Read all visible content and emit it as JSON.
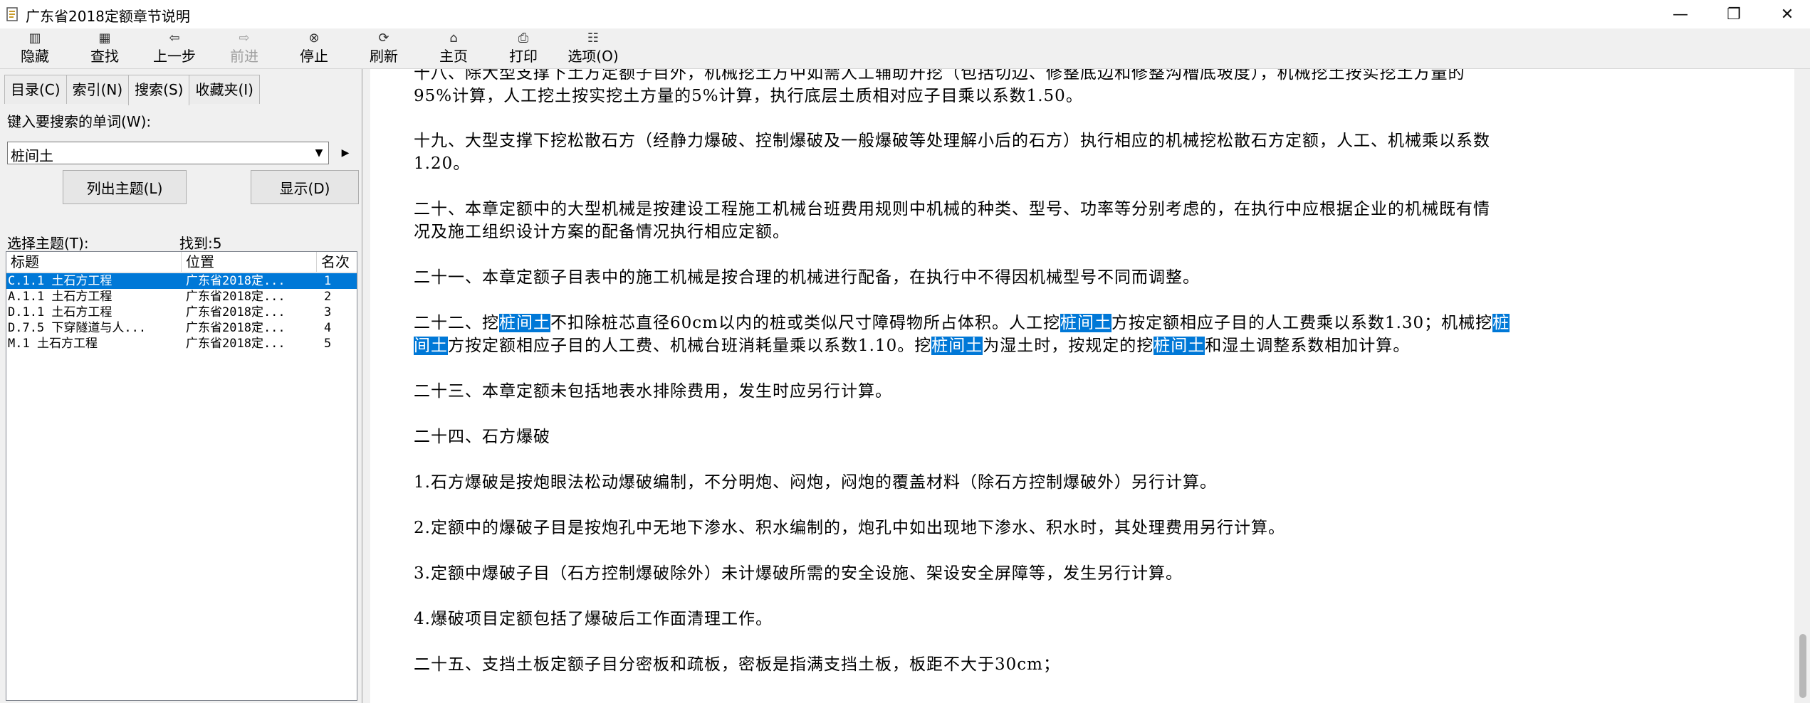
{
  "window": {
    "title": "广东省2018定额章节说明"
  },
  "toolbar": {
    "buttons": [
      {
        "label": "隐藏",
        "icon": "hide-icon"
      },
      {
        "label": "查找",
        "icon": "find-icon"
      },
      {
        "label": "上一步",
        "icon": "back-arrow-icon"
      },
      {
        "label": "前进",
        "icon": "forward-arrow-icon"
      },
      {
        "label": "停止",
        "icon": "stop-icon"
      },
      {
        "label": "刷新",
        "icon": "refresh-icon"
      },
      {
        "label": "主页",
        "icon": "home-icon"
      },
      {
        "label": "打印",
        "icon": "print-icon"
      },
      {
        "label": "选项(O)",
        "icon": "options-icon"
      }
    ]
  },
  "left": {
    "tabs": [
      "目录(C)",
      "索引(N)",
      "搜索(S)",
      "收藏夹(I)"
    ],
    "search_label": "键入要搜索的单词(W):",
    "search_value": "桩间土",
    "list_topics_button": "列出主题(L)",
    "display_button": "显示(D)",
    "select_topic_label": "选择主题(T):",
    "found_label": "找到:5",
    "columns": [
      "标题",
      "位置",
      "名次"
    ],
    "rows": [
      {
        "title": "C.1.1 土石方工程",
        "location": "广东省2018定...",
        "rank": "1"
      },
      {
        "title": "A.1.1 土石方工程",
        "location": "广东省2018定...",
        "rank": "2"
      },
      {
        "title": "D.1.1 土石方工程",
        "location": "广东省2018定...",
        "rank": "3"
      },
      {
        "title": "D.7.5 下穿隧道与人...",
        "location": "广东省2018定...",
        "rank": "4"
      },
      {
        "title": "M.1 土石方工程",
        "location": "广东省2018定...",
        "rank": "5"
      }
    ]
  },
  "content": {
    "p18_l1": "十八、除大型支撑下土方定额子目外，机械挖土方中如需人工辅助开挖（包括切边、修整底边和修整沟槽底坡度），机械挖土按实挖土方量的",
    "p18_l2": "95%计算，人工挖土按实挖土方量的5%计算，执行底层土质相对应子目乘以系数1.50。",
    "p19_l1": "十九、大型支撑下挖松散石方（经静力爆破、控制爆破及一般爆破等处理解小后的石方）执行相应的机械挖松散石方定额，人工、机械乘以系数",
    "p19_l2": "1.20。",
    "p20_l1": "二十、本章定额中的大型机械是按建设工程施工机械台班费用规则中机械的种类、型号、功率等分别考虑的，在执行中应根据企业的机械既有情",
    "p20_l2": "况及施工组织设计方案的配备情况执行相应定额。",
    "p21": "二十一、本章定额子目表中的施工机械是按合理的机械进行配备，在执行中不得因机械型号不同而调整。",
    "p22_l1": [
      {
        "t": "二十二、挖",
        "h": false
      },
      {
        "t": "桩间土",
        "h": true
      },
      {
        "t": "不扣除桩芯直径60cm以内的桩或类似尺寸障碍物所占体积。人工挖",
        "h": false
      },
      {
        "t": "桩间土",
        "h": true
      },
      {
        "t": "方按定额相应子目的人工费乘以系数1.30；机械挖",
        "h": false
      },
      {
        "t": "桩",
        "h": true
      }
    ],
    "p22_l2": [
      {
        "t": "间土",
        "h": true
      },
      {
        "t": "方按定额相应子目的人工费、机械台班消耗量乘以系数1.10。挖",
        "h": false
      },
      {
        "t": "桩间土",
        "h": true
      },
      {
        "t": "为湿土时，按规定的挖",
        "h": false
      },
      {
        "t": "桩间土",
        "h": true
      },
      {
        "t": "和湿土调整系数相加计算。",
        "h": false
      }
    ],
    "p23": "二十三、本章定额未包括地表水排除费用，发生时应另行计算。",
    "p24": "二十四、石方爆破",
    "p24_1": "1.石方爆破是按炮眼法松动爆破编制，不分明炮、闷炮，闷炮的覆盖材料（除石方控制爆破外）另行计算。",
    "p24_2": "2.定额中的爆破子目是按炮孔中无地下渗水、积水编制的，炮孔中如出现地下渗水、积水时，其处理费用另行计算。",
    "p24_3": "3.定额中爆破子目（石方控制爆破除外）未计爆破所需的安全设施、架设安全屏障等，发生另行计算。",
    "p24_4": "4.爆破项目定额包括了爆破后工作面清理工作。",
    "p25": "二十五、支挡土板定额子目分密板和疏板，密板是指满支挡土板，板距不大于30cm；"
  }
}
